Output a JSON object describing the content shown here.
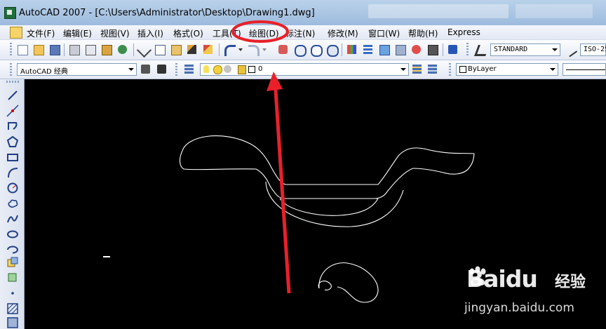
{
  "window": {
    "title": "AutoCAD 2007 - [C:\\Users\\Administrator\\Desktop\\Drawing1.dwg]",
    "app_icon": "autocad-icon"
  },
  "menubar": {
    "doc_icon": "drawing-doc-icon",
    "items": [
      {
        "label": "文件(F)"
      },
      {
        "label": "编辑(E)"
      },
      {
        "label": "视图(V)"
      },
      {
        "label": "插入(I)"
      },
      {
        "label": "格式(O)"
      },
      {
        "label": "工具(T)"
      },
      {
        "label": "绘图(D)"
      },
      {
        "label": "标注(N)"
      },
      {
        "label": "修改(M)"
      },
      {
        "label": "窗口(W)"
      },
      {
        "label": "帮助(H)"
      },
      {
        "label": "Express"
      }
    ]
  },
  "toolbar1": {
    "text_style": "STANDARD",
    "dim_style": "ISO-25"
  },
  "toolbar2": {
    "workspace": "AutoCAD 经典",
    "layer": "0",
    "color": "ByLayer"
  },
  "watermark": {
    "brand": "Baidu",
    "sub": "经验",
    "url": "jingyan.baidu.com"
  },
  "annotation": {
    "highlighted_menu": "绘图(D)",
    "color": "#e8202a"
  },
  "colors": {
    "canvas": "#000000",
    "drawing_lines": "#ffffff"
  }
}
